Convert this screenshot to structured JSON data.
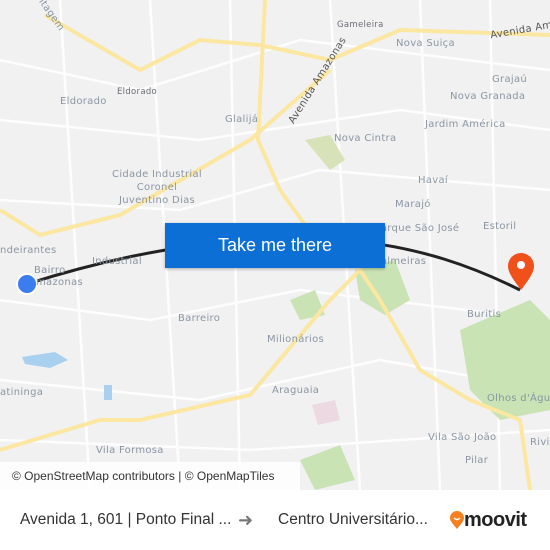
{
  "map": {
    "labels": {
      "gameleira": "Gameleira",
      "avenida_amazonas_top": "Avenida Am",
      "nova_suica": "Nova Suiça",
      "grajau": "Grajaú",
      "nova_granada": "Nova Granada",
      "jardim_america": "Jardim América",
      "eldorado_station": "Eldorado",
      "eldorado": "Eldorado",
      "glalija": "Glalijá",
      "avenida_amazonas_diag": "Avenida Amazonas",
      "nova_cintra": "Nova Cintra",
      "cidade_industrial_1": "Cidade Industrial",
      "cidade_industrial_2": "Coronel",
      "cidade_industrial_3": "Juventino Dias",
      "havai": "Havaí",
      "marajo": "Marajó",
      "parque_sao_jose": "Parque São José",
      "estoril": "Estoril",
      "bandeirantes": "ndeirantes",
      "industrial": "Industrial",
      "bairro_1": "Bairro",
      "bairro_2": "mazonas",
      "palmeiras": "Palmeiras",
      "barreiro": "Barreiro",
      "buritis": "Buritis",
      "milionarios": "Milionários",
      "jatininga": "atininga",
      "araguaia": "Araguaia",
      "olhos_dagua": "Olhos d'Águ",
      "vila_sao_joao": "Vila São João",
      "rivi": "Rivi",
      "vila_formosa": "Vila Formosa",
      "pilar": "Pilar",
      "contagem": "ntagem"
    },
    "origin_marker_color": "#3b7cf0",
    "destination_marker_color": "#f0501a",
    "route_color": "#222222",
    "attribution": "© OpenStreetMap contributors | © OpenMapTiles"
  },
  "cta": {
    "label": "Take me there",
    "color": "#0b6fd6"
  },
  "footer": {
    "from": "Avenida 1, 601 | Ponto Final ...",
    "arrow_icon": "arrow-right-icon",
    "to": "Centro Universitário...",
    "brand": "moovit",
    "brand_color": "#f5801f"
  }
}
